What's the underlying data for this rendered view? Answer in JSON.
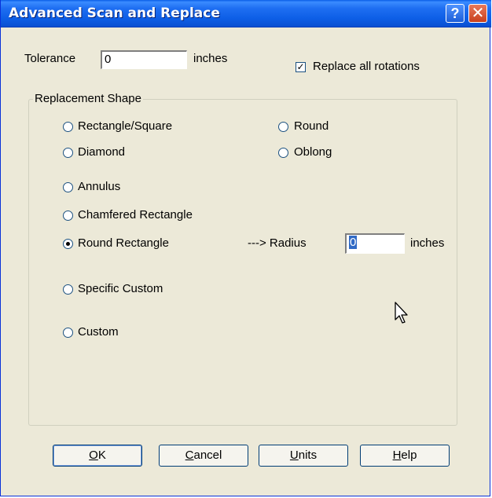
{
  "window": {
    "title": "Advanced Scan and Replace"
  },
  "titlebar": {
    "help_glyph": "?",
    "close_glyph": "✕"
  },
  "tolerance": {
    "label": "Tolerance",
    "value": "0",
    "units": "inches"
  },
  "replace_all_rotations": {
    "label": "Replace all rotations",
    "checked": true
  },
  "replacement_shape": {
    "group_label": "Replacement Shape",
    "options": [
      {
        "label": "Rectangle/Square",
        "checked": false
      },
      {
        "label": "Round",
        "checked": false
      },
      {
        "label": "Diamond",
        "checked": false
      },
      {
        "label": "Oblong",
        "checked": false
      },
      {
        "label": "Annulus",
        "checked": false
      },
      {
        "label": "Chamfered Rectangle",
        "checked": false
      },
      {
        "label": "Round Rectangle",
        "checked": true
      },
      {
        "label": "Specific Custom",
        "checked": false
      },
      {
        "label": "Custom",
        "checked": false
      }
    ],
    "radius": {
      "label": "---> Radius",
      "value": "0",
      "units": "inches"
    }
  },
  "buttons": {
    "ok": {
      "label": "OK",
      "mnemonic": "O",
      "rest": "K"
    },
    "cancel": {
      "label": "Cancel",
      "mnemonic": "C",
      "rest": "ancel"
    },
    "units": {
      "label": "Units",
      "mnemonic": "U",
      "rest": "nits"
    },
    "help": {
      "label": "Help",
      "mnemonic": "H",
      "rest": "elp"
    }
  },
  "colors": {
    "titlebar": "#0a5ee8",
    "dialog_bg": "#ece9d8",
    "frame": "#0831d9"
  }
}
